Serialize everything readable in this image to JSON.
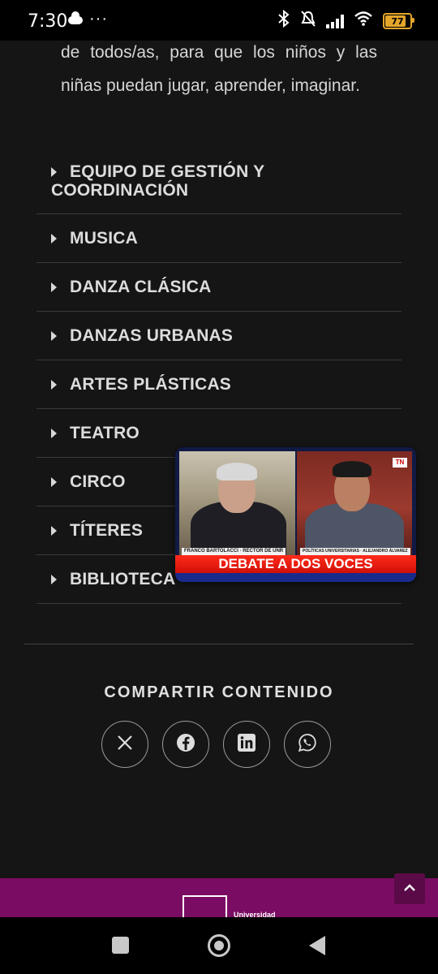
{
  "status_bar": {
    "time": "7:30",
    "more": "···",
    "battery_level": "77",
    "icons": [
      "cloud-icon",
      "bluetooth-icon",
      "mute-icon",
      "signal-icon",
      "wifi-icon",
      "battery-icon"
    ]
  },
  "intro": {
    "line1": "de todos/as, para que los niños y las",
    "line2": "niñas puedan jugar, aprender, imaginar."
  },
  "accordion": {
    "items": [
      {
        "label": "EQUIPO DE GESTIÓN Y COORDINACIÓN"
      },
      {
        "label": "MUSICA"
      },
      {
        "label": "DANZA CLÁSICA"
      },
      {
        "label": "DANZAS URBANAS"
      },
      {
        "label": "ARTES PLÁSTICAS"
      },
      {
        "label": "TEATRO"
      },
      {
        "label": "CIRCO"
      },
      {
        "label": "TÍTERES"
      },
      {
        "label": "BIBLIOTECA"
      }
    ]
  },
  "share": {
    "title": "COMPARTIR CONTENIDO",
    "buttons": [
      "x-icon",
      "facebook-icon",
      "linkedin-icon",
      "whatsapp-icon"
    ]
  },
  "video": {
    "banner": "DEBATE A DOS VOCES",
    "tag_left": "FRANCO BARTOLACCI · RECTOR DE UNR",
    "tag_right": "POLÍTICAS UNIVERSITARIAS · ALEJANDRO ÁLVAREZ",
    "logo": "TN"
  },
  "footer": {
    "brand": "Universidad"
  },
  "colors": {
    "background": "#151515",
    "footer": "#7b0c63",
    "banner": "#e5190e"
  }
}
